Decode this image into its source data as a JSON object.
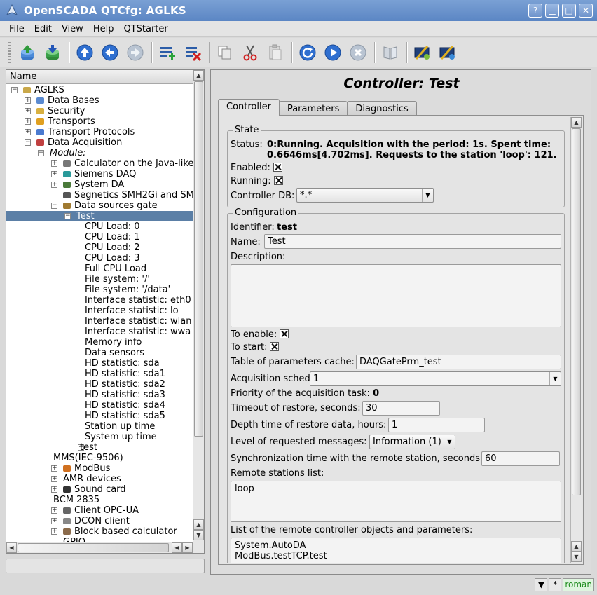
{
  "window": {
    "title": "OpenSCADA QTCfg: AGLKS"
  },
  "menu": [
    "File",
    "Edit",
    "View",
    "Help",
    "QTStarter"
  ],
  "toolbar": {
    "icons": [
      "load-db-icon",
      "save-db-icon",
      "up-icon",
      "back-icon",
      "forward-icon",
      "add-item-icon",
      "delete-item-icon",
      "copy-icon",
      "cut-icon",
      "paste-icon",
      "refresh-icon",
      "start-icon",
      "stop-icon",
      "manual-icon",
      "qtcfg-icon",
      "webcfg-icon"
    ]
  },
  "tree": {
    "header": "Name",
    "rows": [
      {
        "label": "AGLKS",
        "level": 0,
        "exp": "-",
        "icon": "station"
      },
      {
        "label": "Data Bases",
        "level": 1,
        "exp": "+",
        "icon": "db"
      },
      {
        "label": "Security",
        "level": 1,
        "exp": "+",
        "icon": "security"
      },
      {
        "label": "Transports",
        "level": 1,
        "exp": "+",
        "icon": "transport"
      },
      {
        "label": "Transport Protocols",
        "level": 1,
        "exp": "+",
        "icon": "protocol"
      },
      {
        "label": "Data Acquisition",
        "level": 1,
        "exp": "-",
        "icon": "daq"
      },
      {
        "label": "Module:",
        "level": 2,
        "exp": "-",
        "icon": "",
        "italic": true
      },
      {
        "label": "Calculator on the Java-like",
        "level": 3,
        "exp": "+",
        "icon": "calc"
      },
      {
        "label": "Siemens DAQ",
        "level": 3,
        "exp": "+",
        "icon": "siemens"
      },
      {
        "label": "System DA",
        "level": 3,
        "exp": "+",
        "icon": "system"
      },
      {
        "label": "Segnetics SMH2Gi and SM",
        "level": 3,
        "exp": "",
        "icon": "segnetics"
      },
      {
        "label": "Data sources gate",
        "level": 3,
        "exp": "-",
        "icon": "gate"
      },
      {
        "label": "Test",
        "level": 4,
        "exp": "-",
        "icon": "",
        "selected": true
      },
      {
        "label": "CPU Load: 0",
        "level": 5,
        "exp": "",
        "icon": ""
      },
      {
        "label": "CPU Load: 1",
        "level": 5,
        "exp": "",
        "icon": ""
      },
      {
        "label": "CPU Load: 2",
        "level": 5,
        "exp": "",
        "icon": ""
      },
      {
        "label": "CPU Load: 3",
        "level": 5,
        "exp": "",
        "icon": ""
      },
      {
        "label": "Full CPU Load",
        "level": 5,
        "exp": "",
        "icon": ""
      },
      {
        "label": "File system: '/'",
        "level": 5,
        "exp": "",
        "icon": ""
      },
      {
        "label": "File system: '/data'",
        "level": 5,
        "exp": "",
        "icon": ""
      },
      {
        "label": "Interface statistic: eth0",
        "level": 5,
        "exp": "",
        "icon": ""
      },
      {
        "label": "Interface statistic: lo",
        "level": 5,
        "exp": "",
        "icon": ""
      },
      {
        "label": "Interface statistic: wlan",
        "level": 5,
        "exp": "",
        "icon": ""
      },
      {
        "label": "Interface statistic: wwa",
        "level": 5,
        "exp": "",
        "icon": ""
      },
      {
        "label": "Memory info",
        "level": 5,
        "exp": "",
        "icon": ""
      },
      {
        "label": "Data sensors",
        "level": 5,
        "exp": "",
        "icon": ""
      },
      {
        "label": "HD statistic: sda",
        "level": 5,
        "exp": "",
        "icon": ""
      },
      {
        "label": "HD statistic: sda1",
        "level": 5,
        "exp": "",
        "icon": ""
      },
      {
        "label": "HD statistic: sda2",
        "level": 5,
        "exp": "",
        "icon": ""
      },
      {
        "label": "HD statistic: sda3",
        "level": 5,
        "exp": "",
        "icon": ""
      },
      {
        "label": "HD statistic: sda4",
        "level": 5,
        "exp": "",
        "icon": ""
      },
      {
        "label": "HD statistic: sda5",
        "level": 5,
        "exp": "",
        "icon": ""
      },
      {
        "label": "Station up time",
        "level": 5,
        "exp": "",
        "icon": ""
      },
      {
        "label": "System up time",
        "level": 5,
        "exp": "",
        "icon": ""
      },
      {
        "label": "test",
        "level": 5,
        "exp": "+",
        "icon": "",
        "offset": -1
      },
      {
        "label": "MMS(IEC-9506)",
        "level": 3,
        "exp": "",
        "icon": "",
        "offset": -1
      },
      {
        "label": "ModBus",
        "level": 3,
        "exp": "+",
        "icon": "modbus"
      },
      {
        "label": "AMR devices",
        "level": 3,
        "exp": "+",
        "icon": ""
      },
      {
        "label": "Sound card",
        "level": 3,
        "exp": "+",
        "icon": "sound"
      },
      {
        "label": "BCM 2835",
        "level": 3,
        "exp": "",
        "icon": "",
        "offset": -1
      },
      {
        "label": "Client OPC-UA",
        "level": 3,
        "exp": "+",
        "icon": "opc"
      },
      {
        "label": "DCON client",
        "level": 3,
        "exp": "+",
        "icon": "dcon"
      },
      {
        "label": "Block based calculator",
        "level": 3,
        "exp": "+",
        "icon": "block"
      },
      {
        "label": "GPIO",
        "level": 3,
        "exp": "",
        "icon": ""
      }
    ]
  },
  "content": {
    "title": "Controller: Test",
    "tabs": [
      "Controller",
      "Parameters",
      "Diagnostics"
    ],
    "state": {
      "group_label": "State",
      "status_label": "Status:",
      "status_line1": "0:Running. Acquisition with the period: 1s. Spent time:",
      "status_line2": "0.6646ms[4.702ms]. Requests to the station 'loop': 121.",
      "enabled_label": "Enabled:",
      "running_label": "Running:",
      "db_label": "Controller DB:",
      "db_value": "*.*"
    },
    "config": {
      "group_label": "Configuration",
      "identifier_label": "Identifier:",
      "identifier_value": "test",
      "name_label": "Name:",
      "name_value": "Test",
      "description_label": "Description:",
      "description_value": "",
      "to_enable_label": "To enable:",
      "to_start_label": "To start:",
      "cache_label": "Table of parameters cache:",
      "cache_value": "DAQGatePrm_test",
      "schedule_label": "Acquisition schedule:",
      "schedule_value": "1",
      "priority_label": "Priority of the acquisition task:",
      "priority_value": "0",
      "timeout_label": "Timeout of restore, seconds:",
      "timeout_value": "30",
      "depth_label": "Depth time of restore data, hours:",
      "depth_value": "1",
      "level_label": "Level of requested messages:",
      "level_value": "Information (1)",
      "sync_label": "Synchronization time with the remote station, seconds:",
      "sync_value": "60",
      "remote_label": "Remote stations list:",
      "remote_value": "loop",
      "objects_label": "List of the remote controller objects and parameters:",
      "objects_value": "System.AutoDA\nModBus.testTCP.test"
    }
  },
  "statusbar": {
    "star": "*",
    "user": "roman"
  }
}
